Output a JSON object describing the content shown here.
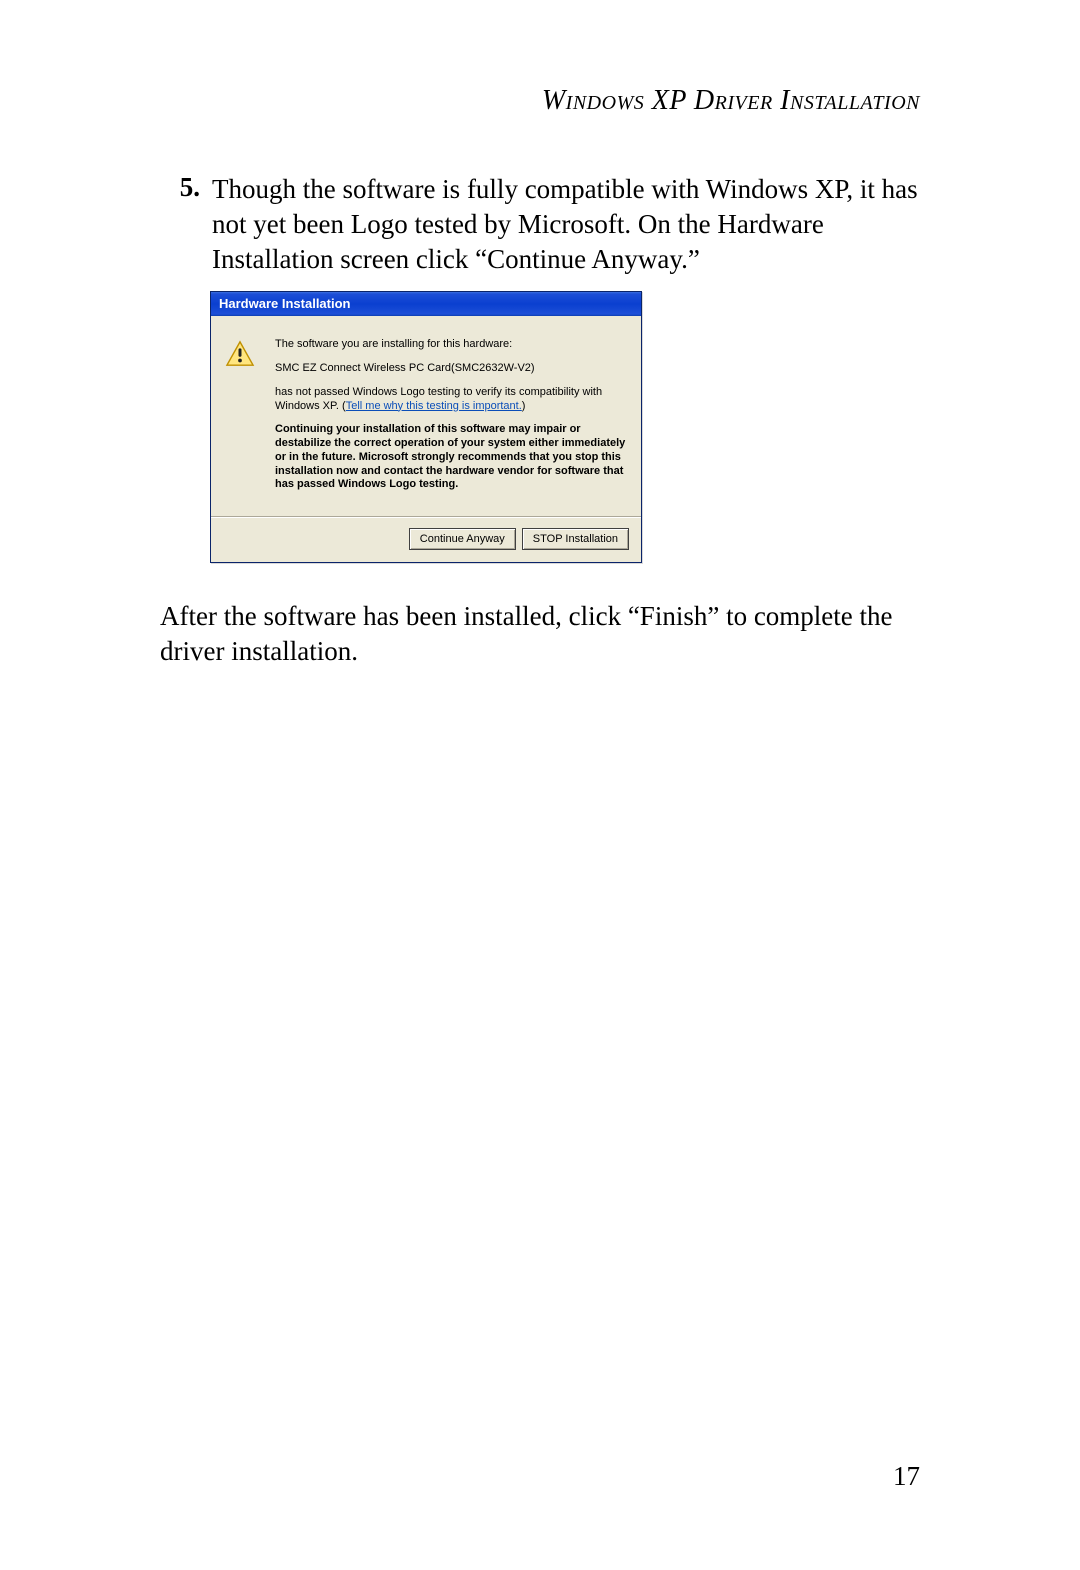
{
  "header": {
    "title": "Windows XP Driver Installation"
  },
  "step": {
    "number": "5.",
    "text": "Though the software is fully compatible with Windows XP, it has not yet been Logo tested by Microsoft. On the Hardware Installation screen click “Continue Anyway.”"
  },
  "dialog": {
    "title": "Hardware Installation",
    "line_intro": "The software you are installing for this hardware:",
    "device_name": "SMC EZ Connect Wireless PC Card(SMC2632W-V2)",
    "not_passed_prefix": "has not passed Windows Logo testing to verify its compatibility with Windows XP. (",
    "link_text": "Tell me why this testing is important.",
    "not_passed_suffix": ")",
    "warning_bold": "Continuing your installation of this software may impair or destabilize the correct operation of your system either immediately or in the future. Microsoft strongly recommends that you stop this installation now and contact the hardware vendor for software that has passed Windows Logo testing.",
    "buttons": {
      "continue": "Continue Anyway",
      "stop": "STOP Installation"
    },
    "icon_name": "warning-icon"
  },
  "after_text": "After the software has been installed, click “Finish” to complete the driver installation.",
  "page_number": "17"
}
